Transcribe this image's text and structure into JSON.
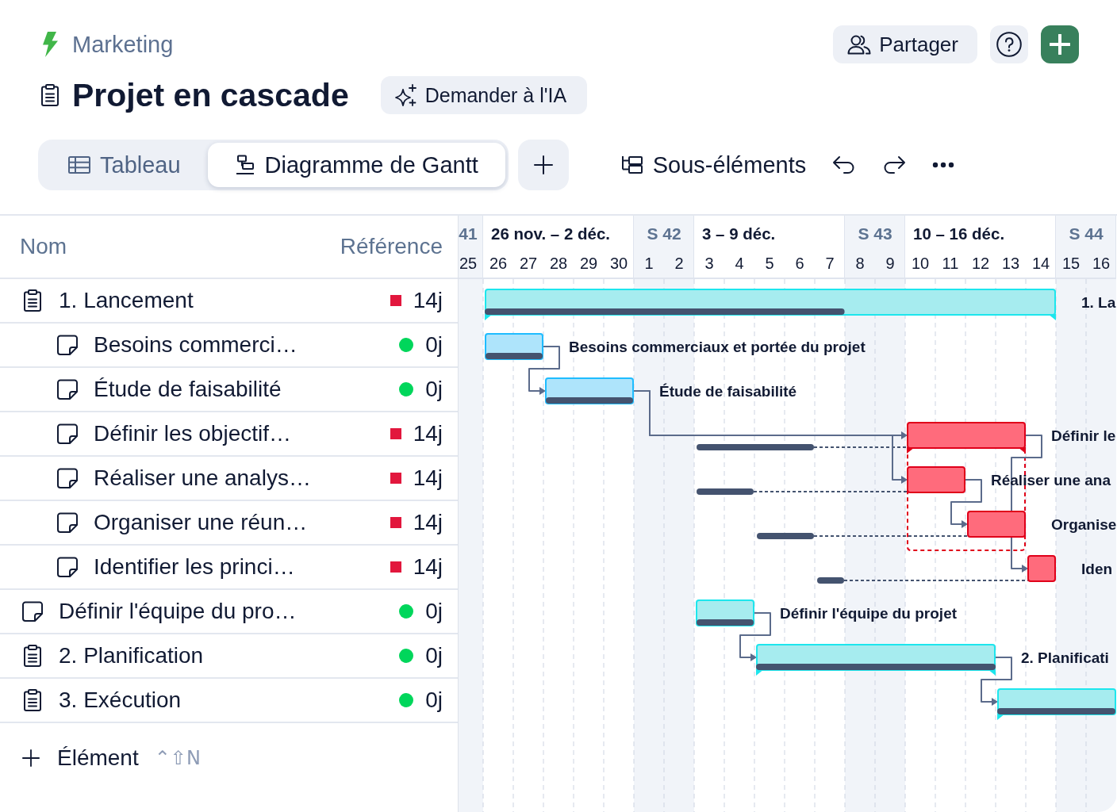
{
  "header": {
    "workspace": "Marketing",
    "title": "Projet en cascade",
    "ask_ai": "Demander à l'IA",
    "share": "Partager"
  },
  "views": [
    {
      "label": "Tableau",
      "kind": "table",
      "selected": false
    },
    {
      "label": "Diagramme de Gantt",
      "kind": "gantt",
      "selected": true
    }
  ],
  "toolbar": {
    "subitems": "Sous-éléments"
  },
  "table": {
    "columns": [
      "Nom",
      "Référence"
    ],
    "rows": [
      {
        "name": "1. Lancement",
        "kind": "group",
        "late": true,
        "color": "#e2173d",
        "reference": "14j",
        "children": [
          {
            "name": "Besoins commerci…",
            "kind": "task",
            "late": false,
            "color": "#00d65b",
            "reference": "0j"
          },
          {
            "name": "Étude de faisabilité",
            "kind": "task",
            "late": false,
            "color": "#00d65b",
            "reference": "0j"
          },
          {
            "name": "Définir les objectif…",
            "kind": "task",
            "late": true,
            "color": "#e2173d",
            "reference": "14j"
          },
          {
            "name": "Réaliser une analys…",
            "kind": "task",
            "late": true,
            "color": "#e2173d",
            "reference": "14j"
          },
          {
            "name": "Organiser une réun…",
            "kind": "task",
            "late": true,
            "color": "#e2173d",
            "reference": "14j"
          },
          {
            "name": "Identifier les princi…",
            "kind": "task",
            "late": true,
            "color": "#e2173d",
            "reference": "14j"
          }
        ]
      },
      {
        "name": "Définir l'équipe du pro…",
        "kind": "task",
        "late": false,
        "color": "#00d65b",
        "reference": "0j"
      },
      {
        "name": "2. Planification",
        "kind": "group",
        "late": false,
        "color": "#00d65b",
        "reference": "0j"
      },
      {
        "name": "3. Exécution",
        "kind": "group",
        "late": false,
        "color": "#00d65b",
        "reference": "0j"
      }
    ]
  },
  "add_item": {
    "label": "Élément",
    "shortcut": "⌃⇧N"
  },
  "gantt": {
    "weeks": [
      {
        "label": "41",
        "weekend": true,
        "days": [
          "25"
        ]
      },
      {
        "label": "26 nov. – 2 déc.",
        "weekend": false,
        "days": [
          "26",
          "27",
          "28",
          "29",
          "30"
        ]
      },
      {
        "label": "S 42",
        "weekend": true,
        "days": [
          "1",
          "2"
        ]
      },
      {
        "label": "3 – 9 déc.",
        "weekend": false,
        "days": [
          "3",
          "4",
          "5",
          "6",
          "7"
        ]
      },
      {
        "label": "S 43",
        "weekend": true,
        "days": [
          "8",
          "9"
        ]
      },
      {
        "label": "10 – 16 déc.",
        "weekend": false,
        "days": [
          "10",
          "11",
          "12",
          "13",
          "14"
        ]
      },
      {
        "label": "S 44",
        "weekend": true,
        "days": [
          "15",
          "16"
        ]
      }
    ],
    "tasks": [
      {
        "label": "1. La",
        "kind": "summary",
        "color": "#a6ecef",
        "level": 0.63,
        "outlined": false,
        "baseline": false
      },
      {
        "label": "Besoins commerciaux et portée du projet",
        "kind": "task",
        "color": "#aee4fb",
        "level": 1,
        "outlined": false,
        "baseline": false
      },
      {
        "label": "Étude de faisabilité",
        "kind": "task",
        "color": "#aee4fb",
        "level": 1,
        "outlined": false,
        "baseline": false
      },
      {
        "label": "Définir le",
        "kind": "summary",
        "color": "#ff6b7c",
        "outlined": true,
        "baseline": true
      },
      {
        "label": "Réaliser une ana",
        "kind": "task",
        "color": "#ff6b7c",
        "outlined": false,
        "baseline": true
      },
      {
        "label": "Organise",
        "kind": "task",
        "color": "#ff6b7c",
        "outlined": false,
        "baseline": true
      },
      {
        "label": "Iden",
        "kind": "task",
        "color": "#ff6b7c",
        "outlined": false,
        "baseline": true
      },
      {
        "label": "Définir l'équipe du projet",
        "kind": "task",
        "color": "#a6ecef",
        "level": 1,
        "outlined": false,
        "baseline": false
      },
      {
        "label": "2. Planificati",
        "kind": "summary",
        "color": "#a6ecef",
        "level": 1,
        "outlined": false,
        "baseline": false
      },
      {
        "kind": "summary",
        "color": "#a6ecef",
        "level": 1,
        "outlined": false,
        "baseline": false
      }
    ]
  }
}
